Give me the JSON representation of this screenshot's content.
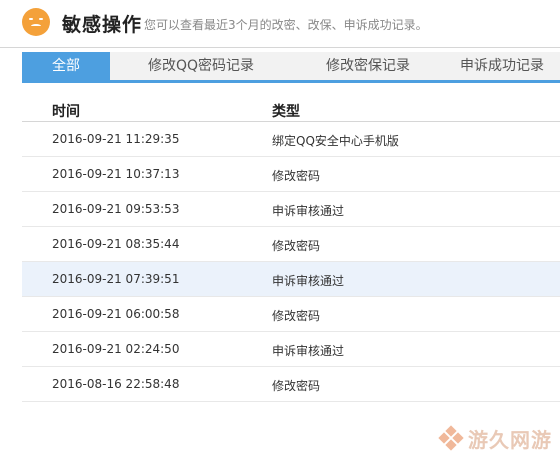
{
  "header": {
    "title": "敏感操作",
    "subtitle": "您可以查看最近3个月的改密、改保、申诉成功记录。"
  },
  "tabs": [
    {
      "label": "全部",
      "active": true
    },
    {
      "label": "修改QQ密码记录",
      "active": false
    },
    {
      "label": "修改密保记录",
      "active": false
    },
    {
      "label": "申诉成功记录",
      "active": false
    }
  ],
  "table": {
    "columns": [
      "时间",
      "类型"
    ],
    "rows": [
      {
        "time": "2016-09-21 11:29:35",
        "type": "绑定QQ安全中心手机版"
      },
      {
        "time": "2016-09-21 10:37:13",
        "type": "修改密码"
      },
      {
        "time": "2016-09-21 09:53:53",
        "type": "申诉审核通过"
      },
      {
        "time": "2016-09-21 08:35:44",
        "type": "修改密码"
      },
      {
        "time": "2016-09-21 07:39:51",
        "type": "申诉审核通过"
      },
      {
        "time": "2016-09-21 06:00:58",
        "type": "修改密码"
      },
      {
        "time": "2016-09-21 02:24:50",
        "type": "申诉审核通过"
      },
      {
        "time": "2016-08-16 22:58:48",
        "type": "修改密码"
      }
    ]
  },
  "watermark": {
    "text": "游久网游"
  },
  "colors": {
    "accent": "#4d9fe0",
    "icon": "#f4a13a",
    "row_highlight": "#ebf2fb"
  }
}
